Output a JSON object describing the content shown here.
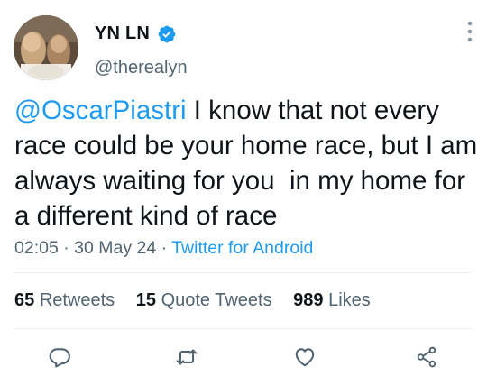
{
  "user": {
    "display_name": "YN LN",
    "handle": "@therealyn",
    "verified": true
  },
  "tweet": {
    "mention": "@OscarPiastri",
    "body": " I know that not every race could be your home race, but I am always waiting for you  in my home for a different kind of race",
    "time": "02:05",
    "separator": "·",
    "date": "30 May 24",
    "source": "Twitter for Android"
  },
  "stats": {
    "retweets_count": "65",
    "retweets_label": "Retweets",
    "quotes_count": "15",
    "quotes_label": "Quote Tweets",
    "likes_count": "989",
    "likes_label": "Likes"
  },
  "icons": {
    "reply": "reply-icon",
    "retweet": "retweet-icon",
    "like": "like-icon",
    "share": "share-icon",
    "more": "more-icon",
    "verified": "verified-badge-icon"
  },
  "colors": {
    "accent": "#1d9bf0",
    "text": "#0f1419",
    "secondary": "#536471"
  }
}
